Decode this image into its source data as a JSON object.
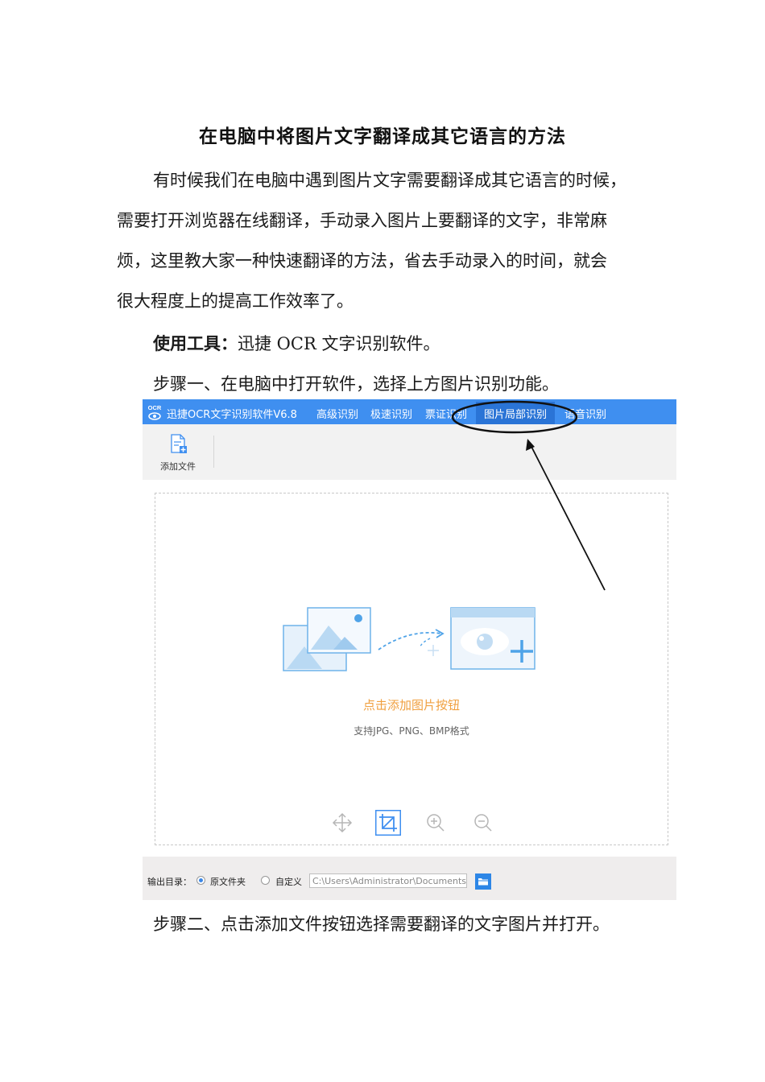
{
  "title": "在电脑中将图片文字翻译成其它语言的方法",
  "intro_lines": [
    "有时候我们在电脑中遇到图片文字需要翻译成其它语言的时候，",
    "需要打开浏览器在线翻译，手动录入图片上要翻译的文字，非常麻",
    "烦，这里教大家一种快速翻译的方法，省去手动录入的时间，就会",
    "很大程度上的提高工作效率了。"
  ],
  "tool_label": "使用工具：",
  "tool_text": "迅捷 OCR 文字识别软件。",
  "step1": "步骤一、在电脑中打开软件，选择上方图片识别功能。",
  "step2": "步骤二、点击添加文件按钮选择需要翻译的文字图片并打开。",
  "app": {
    "logo_text": "OCR",
    "name": "迅捷OCR文字识别软件V6.8",
    "menu": [
      "高级识别",
      "极速识别",
      "票证识别",
      "图片局部识别",
      "语音识别"
    ],
    "active_menu": "图片局部识别",
    "add_file_label": "添加文件",
    "drop_main": "点击添加图片按钮",
    "drop_sub": "支持JPG、PNG、BMP格式",
    "output_label": "输出目录：",
    "option_original": "原文件夹",
    "option_custom": "自定义",
    "output_path": "C:\\Users\\Administrator\\Documents",
    "accent_color": "#3f8ff0",
    "highlight_color": "#f0a040"
  }
}
